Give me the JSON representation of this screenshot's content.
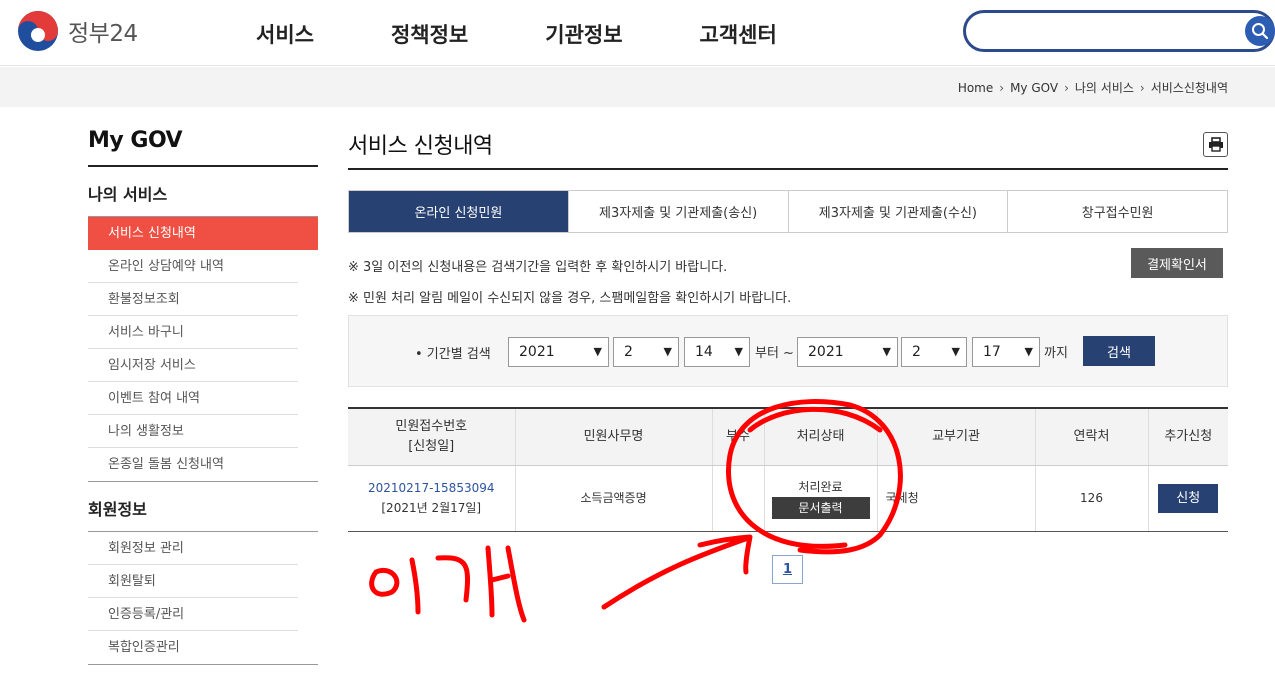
{
  "header": {
    "logo_text": "정부24",
    "nav": [
      "서비스",
      "정책정보",
      "기관정보",
      "고객센터"
    ],
    "search_placeholder": ""
  },
  "breadcrumb": [
    "Home",
    "My GOV",
    "나의 서비스",
    "서비스신청내역"
  ],
  "sidebar": {
    "title": "My GOV",
    "section1": "나의 서비스",
    "items1": [
      "서비스 신청내역",
      "온라인 상담예약 내역",
      "환불정보조회",
      "서비스 바구니",
      "임시저장 서비스",
      "이벤트 참여 내역",
      "나의 생활정보",
      "온종일 돌봄 신청내역"
    ],
    "section2": "회원정보",
    "items2": [
      "회원정보 관리",
      "회원탈퇴",
      "인증등록/관리",
      "복합인증관리"
    ]
  },
  "main": {
    "title": "서비스 신청내역",
    "tabs": [
      "온라인 신청민원",
      "제3자제출 및 기관제출(송신)",
      "제3자제출 및 기관제출(수신)",
      "창구접수민원"
    ],
    "notice1": "※ 3일 이전의 신청내용은 검색기간을 입력한 후 확인하시기 바랍니다.",
    "notice2": "※ 민원 처리 알림 메일이 수신되지 않을 경우, 스팸메일함을 확인하시기 바랍니다.",
    "receipt_button": "결제확인서",
    "filter": {
      "label": "• 기간별 검색",
      "from_year": "2021",
      "from_month": "2",
      "from_day": "14",
      "from_text": "부터 ~",
      "to_year": "2021",
      "to_month": "2",
      "to_day": "17",
      "to_text": "까지",
      "search_button": "검색"
    },
    "table": {
      "headers": [
        "민원접수번호",
        "[신청일]",
        "민원사무명",
        "부수",
        "처리상태",
        "교부기관",
        "연락처",
        "추가신청"
      ],
      "row": {
        "receipt_no": "20210217-15853094",
        "date": "[2021년 2월17일]",
        "service_name": "소득금액증명",
        "copies": "",
        "status": "처리완료",
        "print_button": "문서출력",
        "agency": "국세청",
        "contact": "126",
        "apply_button": "신청"
      }
    },
    "page": "1"
  },
  "annotation": {
    "color": "#ff0000",
    "text": "이거"
  }
}
